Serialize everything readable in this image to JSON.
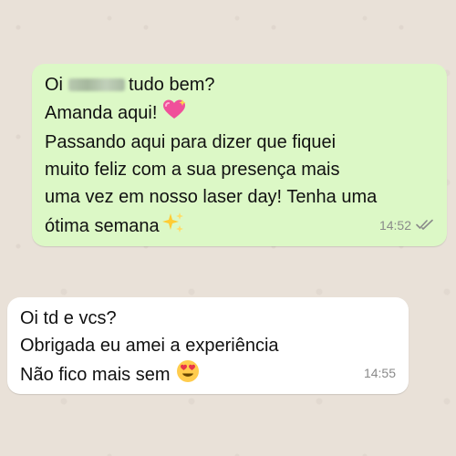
{
  "outgoing": {
    "line1_start": "Oi",
    "line1_end": "tudo bem?",
    "line2": "Amanda aqui!",
    "line3": "Passando aqui para dizer que fiquei",
    "line4": "muito feliz com a sua presença mais",
    "line5": "uma vez em nosso laser day! Tenha uma",
    "line6": "ótima semana",
    "time": "14:52",
    "read_status_icon": "double-check-icon",
    "emoji_heart": "sparkling-heart-icon",
    "emoji_sparkles": "sparkles-icon",
    "bubble_color": "#dcf8c6"
  },
  "incoming": {
    "line1": "Oi td e vcs?",
    "line2": "Obrigada eu amei a experiência",
    "line3": "Não fico mais sem",
    "time": "14:55",
    "emoji_face": "heart-eyes-face-icon",
    "bubble_color": "#ffffff"
  },
  "colors": {
    "wallpaper": "#e9e1d8",
    "timestamp": "#8a8a8a"
  }
}
